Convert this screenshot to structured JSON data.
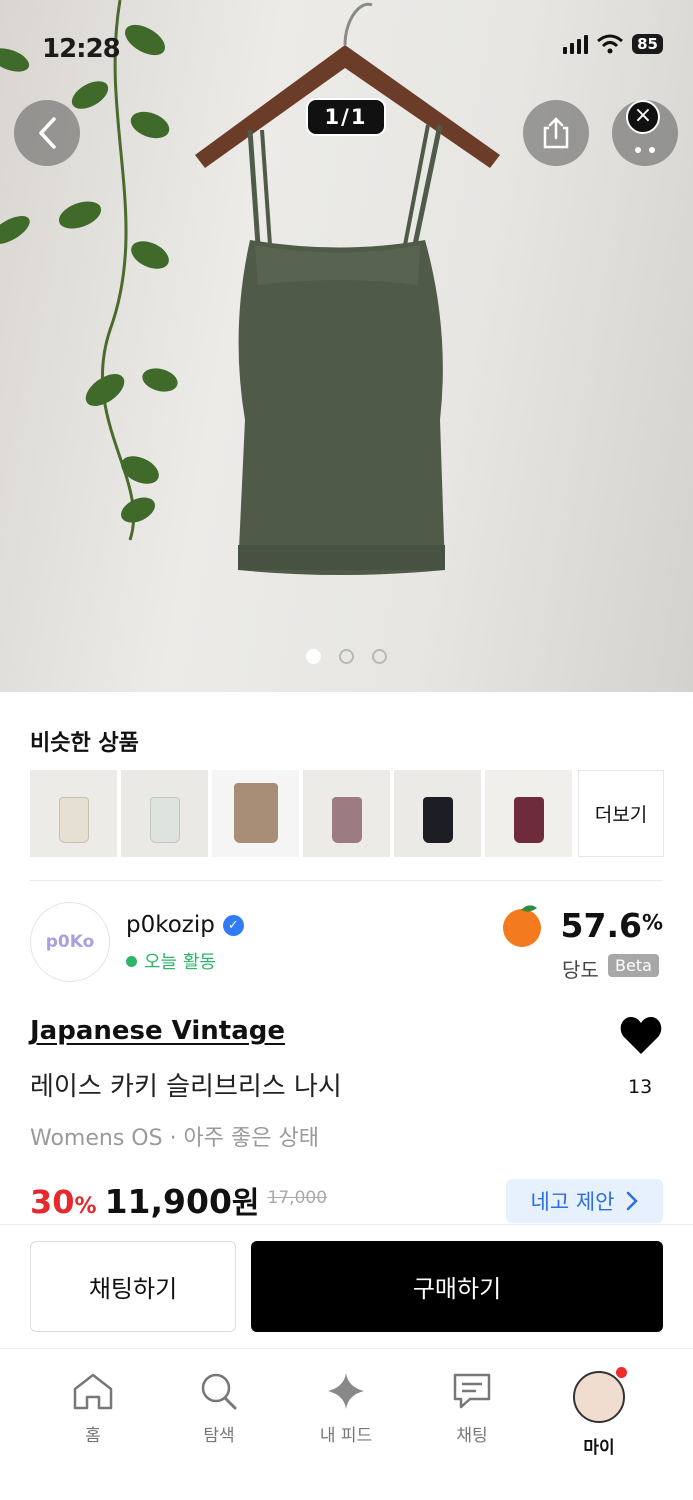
{
  "status_bar": {
    "time": "12:28",
    "battery": "85"
  },
  "hero": {
    "image_counter": "1/1",
    "carousel_dots": 3,
    "active_dot": 0
  },
  "similar": {
    "title": "비슷한 상품",
    "thumb_colors": [
      "#e6e0d2",
      "#dfe3e0",
      "#a88e76",
      "#9c7c80",
      "#1d1d24",
      "#6e2b3a"
    ],
    "more_label": "더보기"
  },
  "seller": {
    "name": "p0kozip",
    "activity": "오늘 활동",
    "avatar_text": "p0Ko",
    "sweetness_value": "57.6",
    "sweetness_unit": "%",
    "sweetness_label": "당도",
    "beta_label": "Beta"
  },
  "product": {
    "brand": "Japanese Vintage",
    "title": "레이스 카키 슬리브리스 나시",
    "meta": "Womens OS · 아주 좋은 상태",
    "like_count": "13",
    "discount": "30",
    "discount_unit": "%",
    "price": "11,900",
    "price_unit": "원",
    "original_price": "17,000",
    "offer_label": "네고 제안"
  },
  "actions": {
    "chat_label": "채팅하기",
    "buy_label": "구매하기"
  },
  "tabs": [
    {
      "label": "홈",
      "icon": "home-icon"
    },
    {
      "label": "탐색",
      "icon": "search-icon"
    },
    {
      "label": "내 피드",
      "icon": "sparkle-icon"
    },
    {
      "label": "채팅",
      "icon": "chat-icon"
    },
    {
      "label": "마이",
      "icon": "profile-avatar"
    }
  ],
  "colors": {
    "accent_red": "#e8292c",
    "offer_blue": "#2c6fe0",
    "active_green": "#2fb46a",
    "khaki": "#4f5a48"
  }
}
